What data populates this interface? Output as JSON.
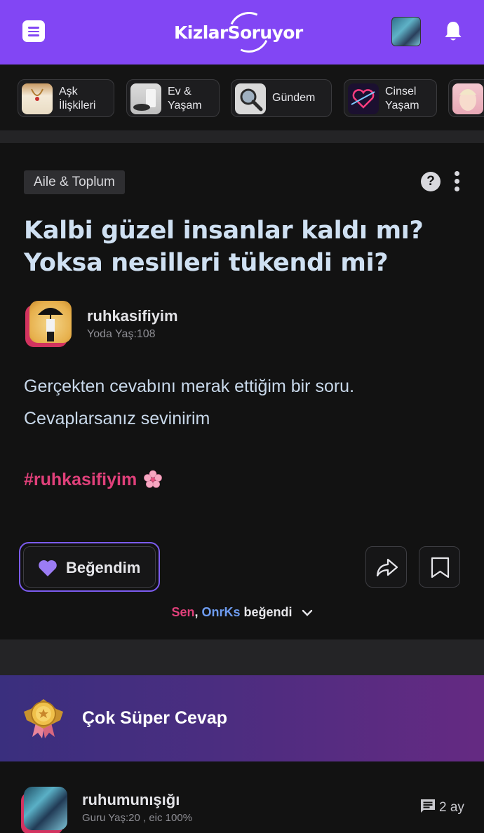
{
  "header": {
    "logo_text": "KizlarSoruyor",
    "menu_icon": "hamburger-icon",
    "notification_icon": "bell-icon",
    "brand_color": "#8246f4"
  },
  "categories": [
    {
      "label": "Aşk\nİlişkileri"
    },
    {
      "label": "Ev &\nYaşam"
    },
    {
      "label": "Gündem"
    },
    {
      "label": "Cinsel\nYaşam"
    }
  ],
  "question": {
    "tag": "Aile & Toplum",
    "title": "Kalbi güzel insanlar kaldı mı? Yoksa nesilleri tükendi mi?",
    "author_name": "ruhkasifiyim",
    "author_meta": "Yoda Yaş:108",
    "body_line1": "Gerçekten cevabını merak ettiğim bir soru.",
    "body_line2": "Cevaplarsanız sevinirim",
    "hashtag": "#ruhkasifiyim",
    "like_label": "Beğendim",
    "liked_by_name1": "Sen",
    "liked_by_sep": ", ",
    "liked_by_name2": "OnrKs",
    "liked_by_suffix": " beğendi"
  },
  "award": {
    "label": "Çok Süper Cevap"
  },
  "answer": {
    "author_name": "ruhumunışığı",
    "author_meta": "Guru Yaş:20 , eic 100%",
    "time": "2 ay"
  }
}
